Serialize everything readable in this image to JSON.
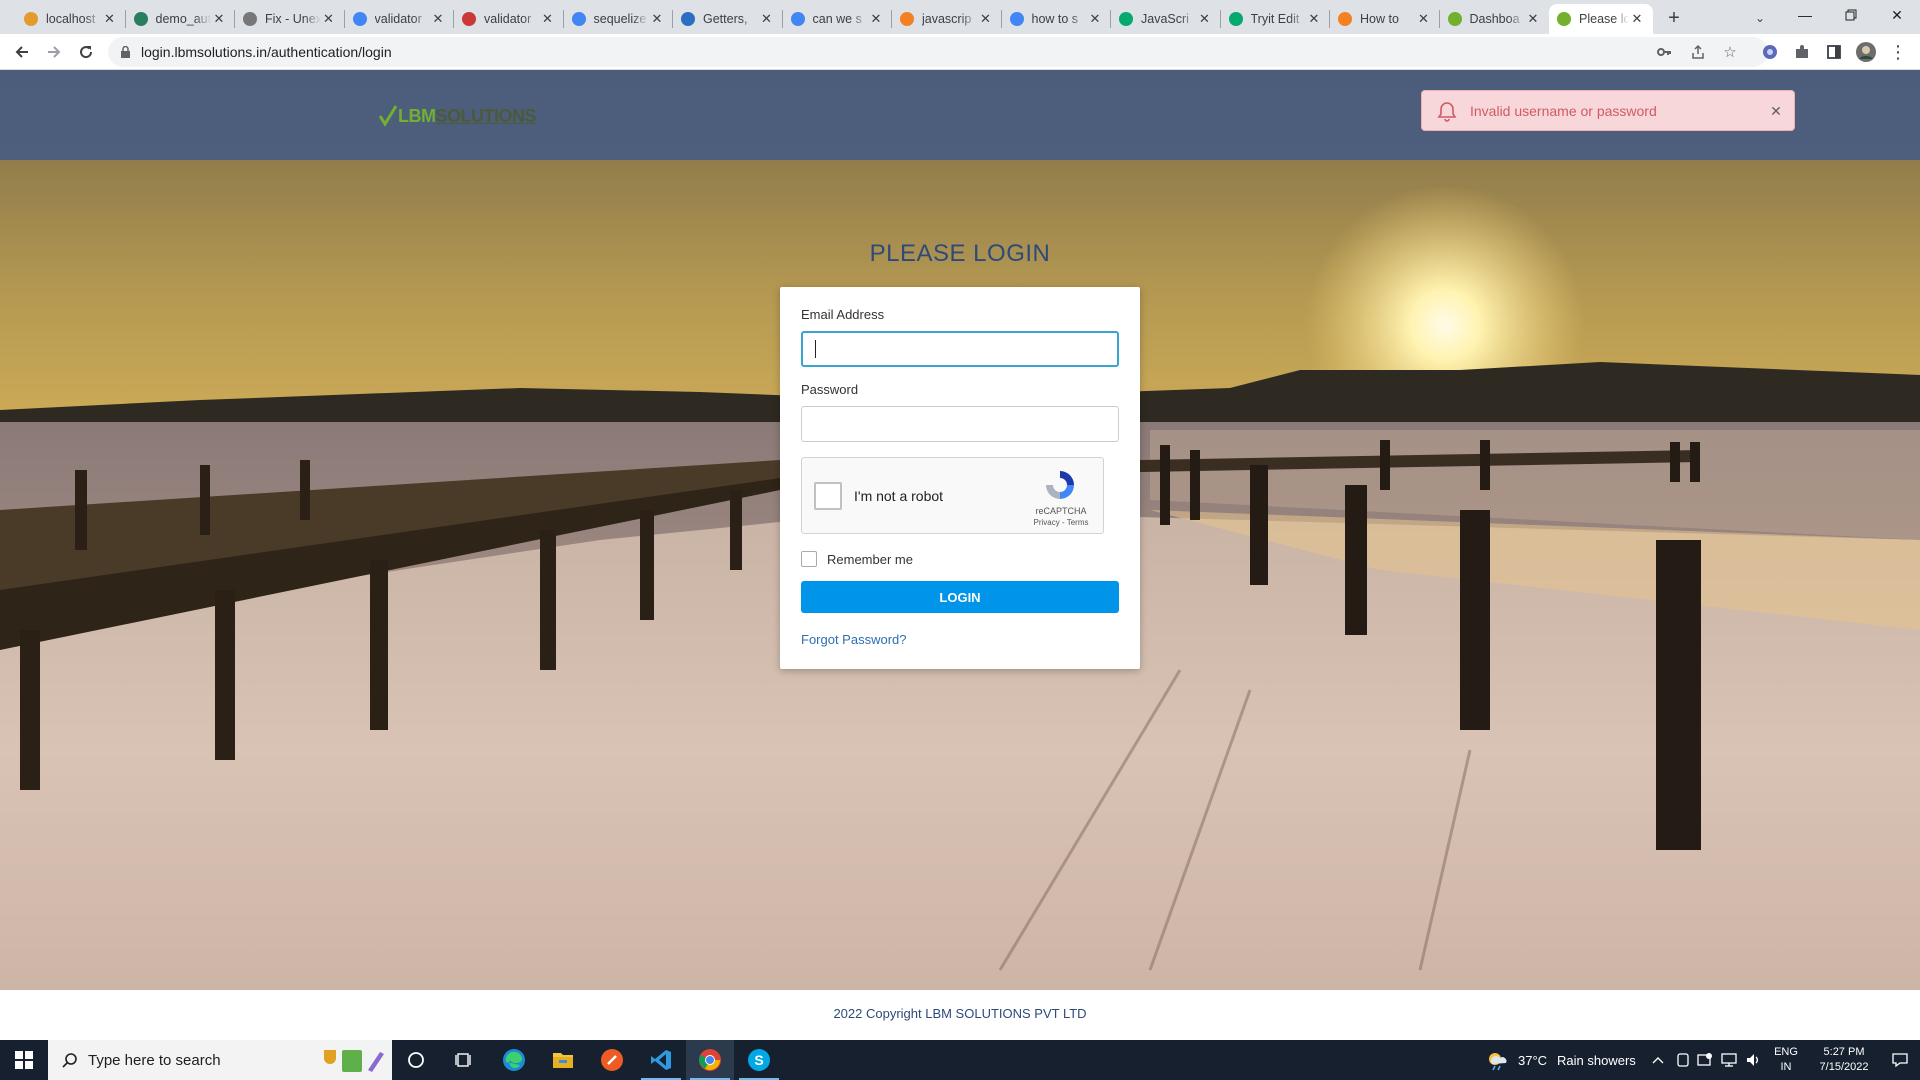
{
  "browser": {
    "tabs": [
      {
        "title": "localhost",
        "icon": "localhost-favicon",
        "color": "#e39b2e"
      },
      {
        "title": "demo_auth",
        "icon": "vue-favicon",
        "color": "#2a7d5e"
      },
      {
        "title": "Fix - Unex",
        "icon": "fix-favicon",
        "color": "#777777"
      },
      {
        "title": "validator",
        "icon": "google-favicon",
        "color": "#4285f4"
      },
      {
        "title": "validator",
        "icon": "npm-favicon",
        "color": "#cb3837"
      },
      {
        "title": "sequelize",
        "icon": "google-favicon",
        "color": "#4285f4"
      },
      {
        "title": "Getters,",
        "icon": "mdn-favicon",
        "color": "#2b6fc2"
      },
      {
        "title": "can we s",
        "icon": "google-favicon",
        "color": "#4285f4"
      },
      {
        "title": "javascrip",
        "icon": "stackoverflow-favicon",
        "color": "#f48024"
      },
      {
        "title": "how to s",
        "icon": "google-favicon",
        "color": "#4285f4"
      },
      {
        "title": "JavaScri",
        "icon": "w3schools-favicon",
        "color": "#04aa6d"
      },
      {
        "title": "Tryit Edit",
        "icon": "w3schools-favicon",
        "color": "#04aa6d"
      },
      {
        "title": "How to",
        "icon": "stackoverflow-favicon",
        "color": "#f48024"
      },
      {
        "title": "Dashboa",
        "icon": "lbm-favicon",
        "color": "#72b02e"
      },
      {
        "title": "Please lo",
        "icon": "lbm-favicon",
        "color": "#72b02e",
        "active": true
      }
    ],
    "new_tab": "+",
    "url": "login.lbmsolutions.in/authentication/login"
  },
  "site": {
    "logo_primary": "LBM",
    "logo_secondary": "SOLUTIONS",
    "brand_color": "#72b02e",
    "toast_message": "Invalid username or password",
    "heading": "PLEASE LOGIN",
    "email_label": "Email Address",
    "email_value": "",
    "password_label": "Password",
    "password_value": "",
    "recaptcha_label": "I'm not a robot",
    "recaptcha_brand": "reCAPTCHA",
    "recaptcha_terms": "Privacy - Terms",
    "remember_label": "Remember me",
    "login_button": "LOGIN",
    "forgot_link": "Forgot Password?",
    "footer": "2022 Copyright LBM SOLUTIONS PVT LTD",
    "accent_color": "#0095e8",
    "error_color": "#f8d7da"
  },
  "taskbar": {
    "search_placeholder": "Type here to search",
    "weather_temp": "37°C",
    "weather_text": "Rain showers",
    "language_1": "ENG",
    "language_2": "IN",
    "time": "5:27 PM",
    "date": "7/15/2022"
  }
}
